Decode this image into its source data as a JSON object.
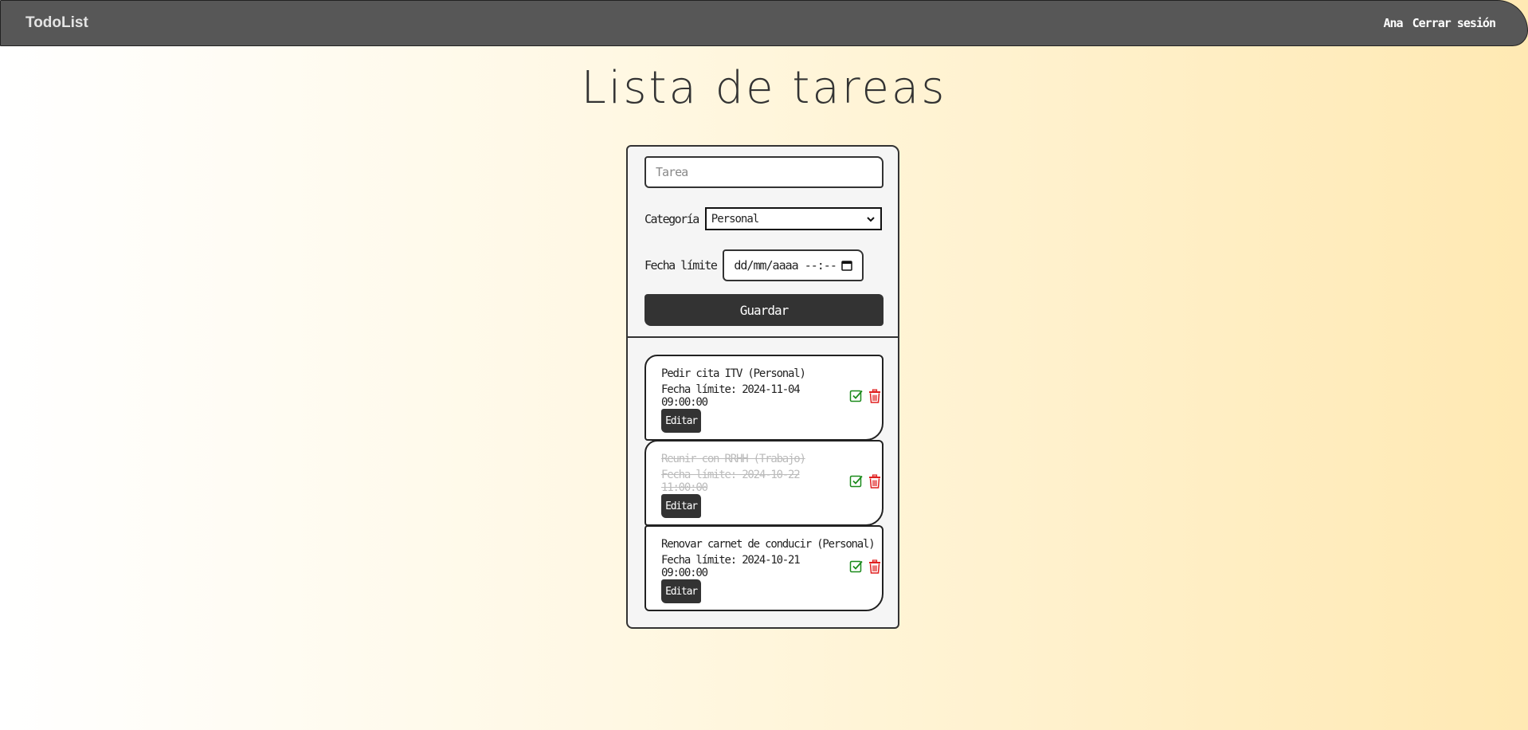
{
  "navbar": {
    "brand": "TodoList",
    "user": "Ana",
    "logout": "Cerrar sesión"
  },
  "page": {
    "title": "Lista de tareas"
  },
  "form": {
    "task_placeholder": "Tarea",
    "category_label": "Categoría",
    "category_selected": "Personal",
    "deadline_label": "Fecha límite",
    "deadline_value": "dd/mm/aaaa --:--",
    "save_label": "Guardar"
  },
  "tasks": [
    {
      "title": "Pedir cita ITV (Personal)",
      "deadline": "Fecha límite: 2024-11-04 09:00:00",
      "completed": false,
      "edit_label": "Editar"
    },
    {
      "title": "Reunir con RRHH (Trabajo)",
      "deadline": "Fecha límite: 2024-10-22 11:00:00",
      "completed": true,
      "edit_label": "Editar"
    },
    {
      "title": "Renovar carnet de conducir (Personal)",
      "deadline": "Fecha límite: 2024-10-21 09:00:00",
      "completed": false,
      "edit_label": "Editar"
    }
  ],
  "icons": {
    "complete": "check-square-icon",
    "delete": "trash-icon",
    "calendar": "calendar-icon",
    "dropdown": "chevron-down-icon"
  },
  "colors": {
    "navbar": "#575757",
    "button": "#333333",
    "check": "#1a8a1a",
    "delete": "#e02020"
  }
}
